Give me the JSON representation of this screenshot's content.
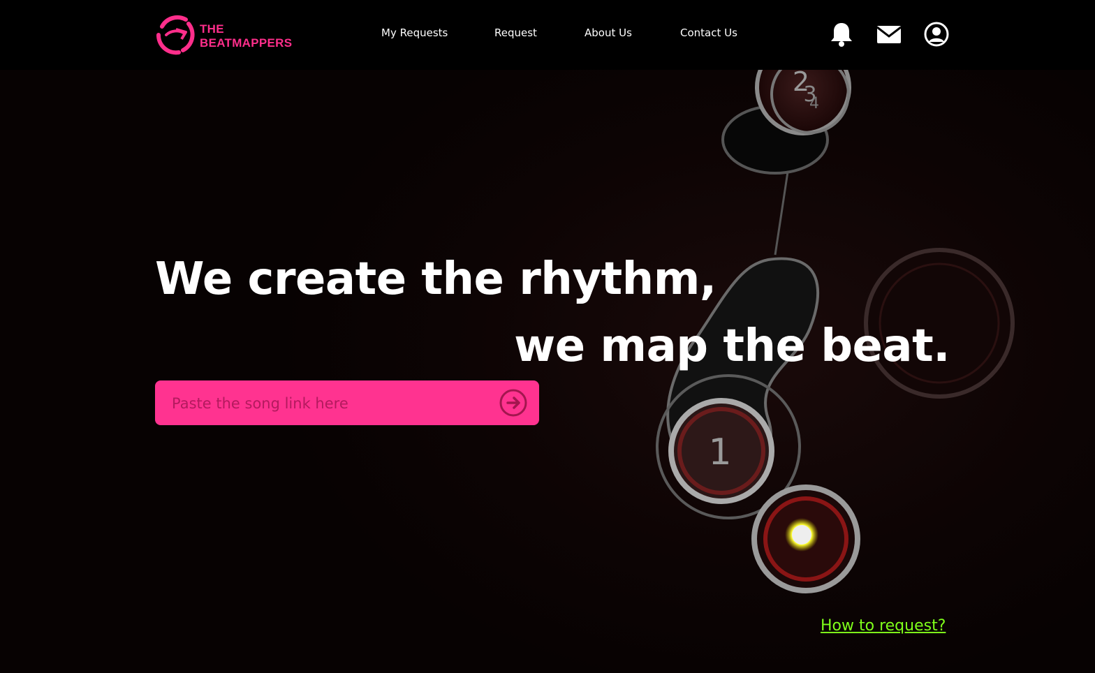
{
  "brand": {
    "line1": "THE",
    "line2": "BEATMAPPERS",
    "accent_color": "#ff2e8b",
    "icon": "logo-mark"
  },
  "nav": {
    "items": [
      {
        "label": "My Requests"
      },
      {
        "label": "Request"
      },
      {
        "label": "About Us"
      },
      {
        "label": "Contact Us"
      }
    ]
  },
  "header_icons": [
    "bell-icon",
    "mail-icon",
    "user-icon"
  ],
  "hero": {
    "headline_1": "We create the rhythm,",
    "headline_2": "we map the beat.",
    "search_placeholder": "Paste the song link here",
    "search_value": "",
    "submit_icon": "arrow-right-circle-icon",
    "search_bg_color": "#ff3390"
  },
  "help": {
    "link_label": "How to request?",
    "link_color": "#7fff1a"
  },
  "background": {
    "hit_circle_numbers": [
      "2",
      "3",
      "4",
      "1"
    ]
  }
}
